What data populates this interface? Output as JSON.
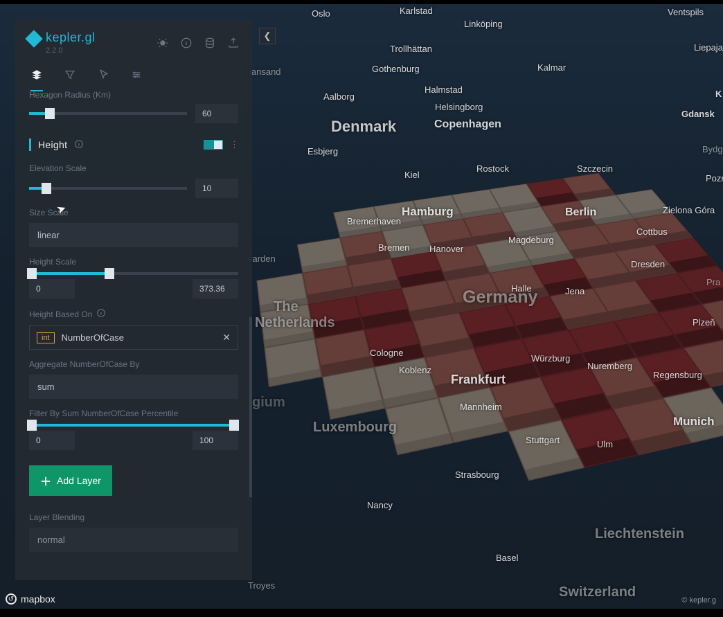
{
  "brand": {
    "name": "kepler.gl",
    "version": "2.2.0"
  },
  "tabs": {
    "layers": "Layers",
    "filters": "Filters",
    "interactions": "Interactions",
    "basemap": "Base map"
  },
  "layer": {
    "radius_label": "Hexagon Radius (Km)",
    "radius_value": "60",
    "height_title": "Height",
    "elevation_scale_label": "Elevation Scale",
    "elevation_scale_value": "10",
    "size_scale_label": "Size Scale",
    "size_scale_value": "linear",
    "height_scale_label": "Height Scale",
    "height_scale_min": "0",
    "height_scale_max": "373.36",
    "height_based_on_label": "Height Based On",
    "field_type": "int",
    "field_name": "NumberOfCase",
    "aggregate_label": "Aggregate NumberOfCase By",
    "aggregate_value": "sum",
    "filter_label": "Filter By Sum NumberOfCase Percentile",
    "filter_min": "0",
    "filter_max": "100",
    "add_layer": "Add Layer",
    "layer_blending_label": "Layer Blending",
    "layer_blending_value": "normal"
  },
  "collapse_tooltip": "Collapse sidebar",
  "attribution": {
    "mapbox": "mapbox",
    "kepler": "© kepler.g"
  },
  "map_labels": {
    "oslo": "Oslo",
    "karlstad": "Karlstad",
    "linkoping": "Linköping",
    "ventspils": "Ventspils",
    "trollhattan": "Trollhättan",
    "liepaja": "Liepaja",
    "kalmar": "Kalmar",
    "gothenburg": "Gothenburg",
    "iansand": "iansand",
    "aalborg": "Aalborg",
    "halmstad": "Halmstad",
    "helsingborg": "Helsingborg",
    "gdansk": "Gdansk",
    "k_right": "K",
    "denmark": "Denmark",
    "copenhagen": "Copenhagen",
    "bydg": "Bydg",
    "esbjerg": "Esbjerg",
    "poznan": "Poznań",
    "kiel": "Kiel",
    "rostock": "Rostock",
    "szczecin": "Szczecin",
    "zielona": "Zielona Góra",
    "netherlands": "The\nNetherlands",
    "hamburg": "Hamburg",
    "bremerhaven": "Bremerhaven",
    "berlin": "Berlin",
    "cottbus": "Cottbus",
    "varden": "varden",
    "bremen": "Bremen",
    "hanover": "Hanover",
    "magdeburg": "Magdeburg",
    "dresden": "Dresden",
    "prague": "Pra",
    "halle": "Halle",
    "jena": "Jena",
    "germany": "Germany",
    "gium": "gium",
    "cologne": "Cologne",
    "plzen": "Plzeň",
    "koblenz": "Koblenz",
    "frankfurt": "Frankfurt",
    "wurzburg": "Würzburg",
    "nuremberg": "Nuremberg",
    "regensburg": "Regensburg",
    "mannheim": "Mannheim",
    "luxembourg": "Luxembourg",
    "stuttgart": "Stuttgart",
    "ulm": "Ulm",
    "munich": "Munich",
    "strasbourg": "Strasbourg",
    "nancy": "Nancy",
    "basel": "Basel",
    "troyes": "Troyes",
    "liechtenstein": "Liechtenstein",
    "switzerland": "Switzerland"
  }
}
